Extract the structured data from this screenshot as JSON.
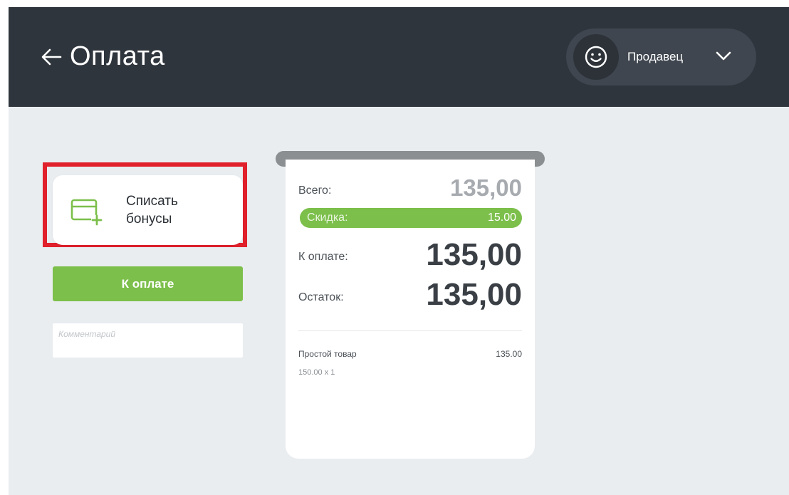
{
  "header": {
    "back_icon": "arrow-left-icon",
    "title": "Оплата",
    "user": {
      "avatar_icon": "smiley-icon",
      "name": "Продавец",
      "dropdown_icon": "chevron-down-icon"
    }
  },
  "actions": {
    "bonus_icon": "card-plus-icon",
    "bonus_label": "Списать бонусы",
    "pay_label": "К оплате",
    "comment_placeholder": "Комментарий",
    "comment_value": ""
  },
  "receipt": {
    "total_label": "Всего:",
    "total_value": "135,00",
    "discount_label": "Скидка:",
    "discount_value": "15.00",
    "topay_label": "К оплате:",
    "topay_value": "135,00",
    "rest_label": "Остаток:",
    "rest_value": "135,00",
    "items": [
      {
        "name": "Простой товар",
        "price": "135.00",
        "qty": "150.00 x 1"
      }
    ]
  },
  "colors": {
    "header_bg": "#2f353d",
    "content_bg": "#e9edf0",
    "accent_green": "#7cbf4b",
    "highlight_red": "#e0202b"
  }
}
